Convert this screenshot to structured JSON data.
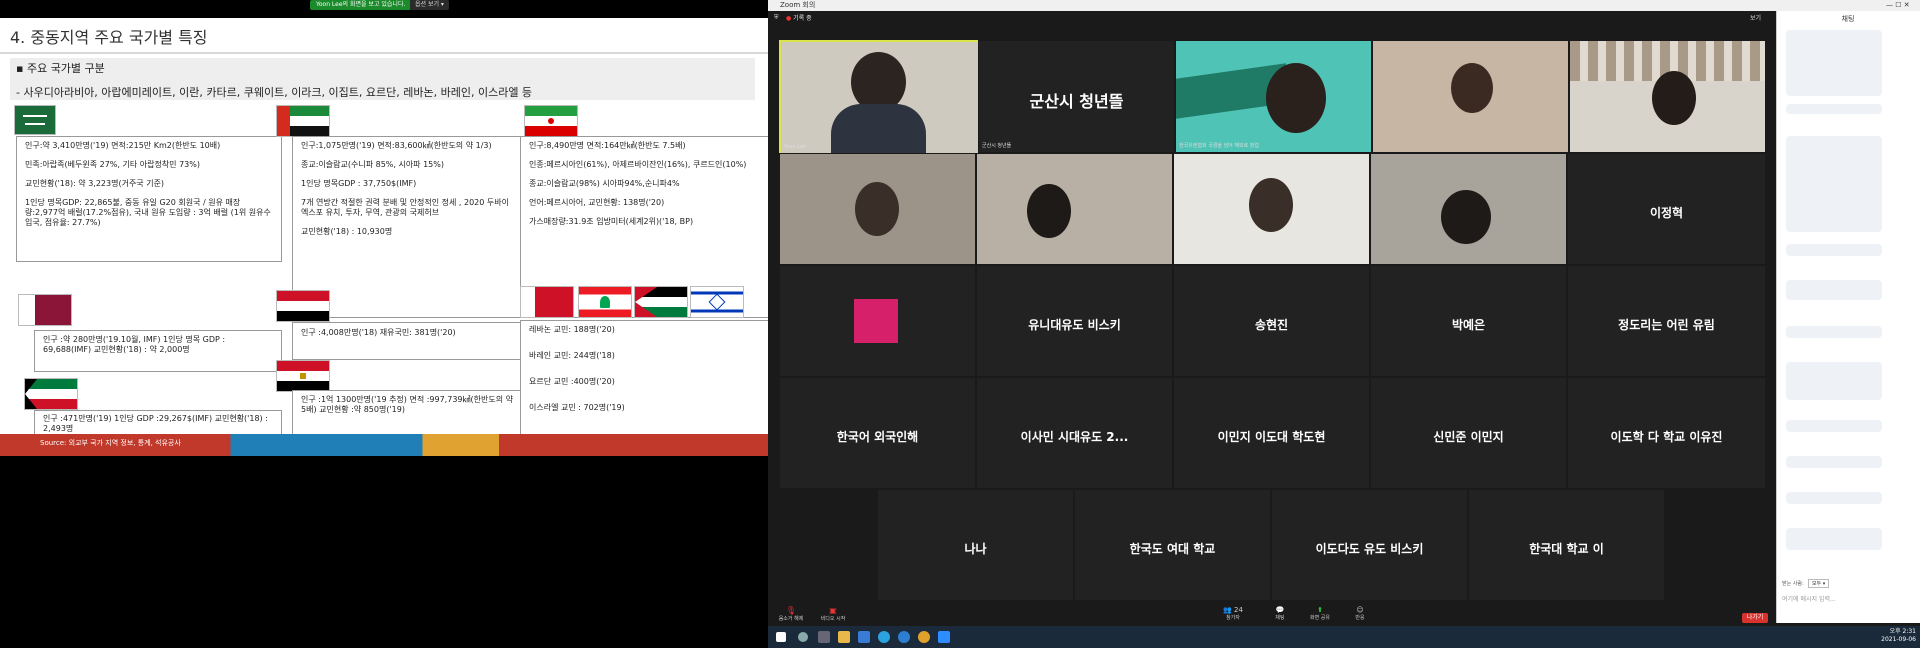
{
  "share": {
    "banner_text": "Yoon Lee의 화면을 보고 있습니다.",
    "view_options": "옵션 보기 ▾"
  },
  "slide": {
    "title": "4. 중동지역 주요 국가별 특징",
    "sub_heading": "▪  주요 국가별 구분",
    "country_list": "- 사우디아라비아, 아랍에미레이트, 이란, 카타르, 쿠웨이트, 이라크, 이집트, 요르단, 레바논, 바레인, 이스라엘 등",
    "saudi": [
      "인구:약 3,410만명('19) 면적:215만 Km2(한반도 10배)",
      "민족:아랍족(베두윈족 27%, 기타 아랍정착민 73%)",
      "교민현황('18): 약 3,223명(거주국 기준)",
      "1인당 명목GDP: 22,865불, 중동 유일 G20 회원국 / 원유 매장량:2,977억 배럴(17.2%점유), 국내 원유 도입량 : 3억 배럴 (1위 원유수입국, 점유율: 27.7%)"
    ],
    "uae": [
      "인구:1,075만명('19) 면적:83,600㎢(한반도의 약 1/3)",
      "종교:이슬람교(수니파 85%, 시아파 15%)",
      "1인당 명목GDP : 37,750$(IMF)",
      "7개 연방간 적절한 권력 분배 및 안정적인 정세 , 2020 두바이 엑스포 유치, 투자, 무역, 관광의 국제허브",
      "교민현황('18) : 10,930명"
    ],
    "iran": [
      "인구:8,490만명 면적:164만㎢(한반도 7.5배)",
      "인종:페르시아인(61%), 아제르바이잔인(16%), 쿠르드인(10%)",
      "종교:이슬람교(98%) 시아파94%,순니파4%",
      "언어:페르시아어, 교민현황: 138명('20)",
      "가스매장량:31.9조 입방미터(세계2위)('18, BP)"
    ],
    "qatar": "인구 :약 280만명('19.10월, IMF) 1인당 명목 GDP : 69,688(IMF) 교민현황('18) : 약 2,000명",
    "kuwait": "인구 :471만명('19) 1인당 GDP :29,267$(IMF) 교민현황('18) : 2,493명",
    "iraq": "인구 :4,008만명('18) 재유국민: 381명('20)",
    "egypt": "인구 :1억 1300만명('19 추정) 면적 :997,739㎢(한반도의 약 5배) 교민현황 :약 850명('19)",
    "others": [
      "레바논 교민: 188명('20)",
      "바레인 교민: 244명('18)",
      "요르단 교민 :400명('20)",
      "이스라엘 교민 : 702명('19)"
    ],
    "source": "Source: 외교부 국가 지역 정보, 통계, 석유공사"
  },
  "zoom": {
    "window_title": "Zoom 회의",
    "recording": "기록 중",
    "view_button": "보기",
    "tiles_row1": [
      {
        "name": "",
        "tag": "Yoon Lee"
      },
      {
        "name": "군산시 청년뜰",
        "tag": "군산시 청년뜰"
      },
      {
        "name": "",
        "tag": "한국유엔협회 국경을 넘어 해외로 창업"
      },
      {
        "name": "",
        "tag": ""
      },
      {
        "name": "",
        "tag": ""
      }
    ],
    "row2_last_name": "이정혁",
    "tiles_row3": [
      "",
      "유니대유도 비스키",
      "송현진",
      "박예은",
      "정도리는 어린 유림"
    ],
    "tiles_row4": [
      "한국어 외국인해",
      "이사민 시대유도 2...",
      "이민지 이도대 학도현",
      "신민준 이민지",
      "이도학 다 학교 이유진"
    ],
    "tiles_row5": [
      "나나",
      "한국도 여대 학교",
      "이도다도 유도 비스키",
      "한국대 학교 이"
    ],
    "chat_title": "채팅",
    "chat_to": "받는 사람:",
    "chat_to_value": "모두 ▾",
    "chat_placeholder": "여기에 메시지 입력...",
    "toolbar": [
      "음소거 해제",
      "비디오 시작",
      "참가자",
      "채팅",
      "화면 공유",
      "반응"
    ],
    "participants_count": "24",
    "leave": "나가기",
    "clock_time": "오후 2:31",
    "clock_date": "2021-09-06"
  }
}
